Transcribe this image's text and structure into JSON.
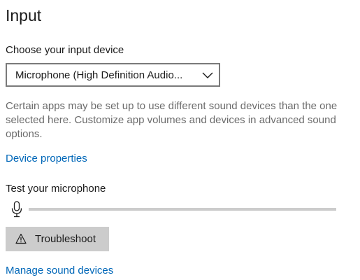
{
  "section": {
    "title": "Input"
  },
  "device": {
    "label": "Choose your input device",
    "selected": "Microphone (High Definition Audio...",
    "description": "Certain apps may be set up to use different sound devices than the one selected here. Customize app volumes and devices in advanced sound options.",
    "properties_link": "Device properties"
  },
  "test": {
    "label": "Test your microphone",
    "level": 0
  },
  "troubleshoot": {
    "label": "Troubleshoot"
  },
  "manage": {
    "link": "Manage sound devices"
  },
  "colors": {
    "link": "#0067b8",
    "description": "#6b6b6b",
    "button_bg": "#cccccc",
    "dropdown_border": "#7a7a7a"
  },
  "icons": {
    "dropdown": "chevron-down-icon",
    "mic": "microphone-icon",
    "troubleshoot": "warning-icon"
  }
}
